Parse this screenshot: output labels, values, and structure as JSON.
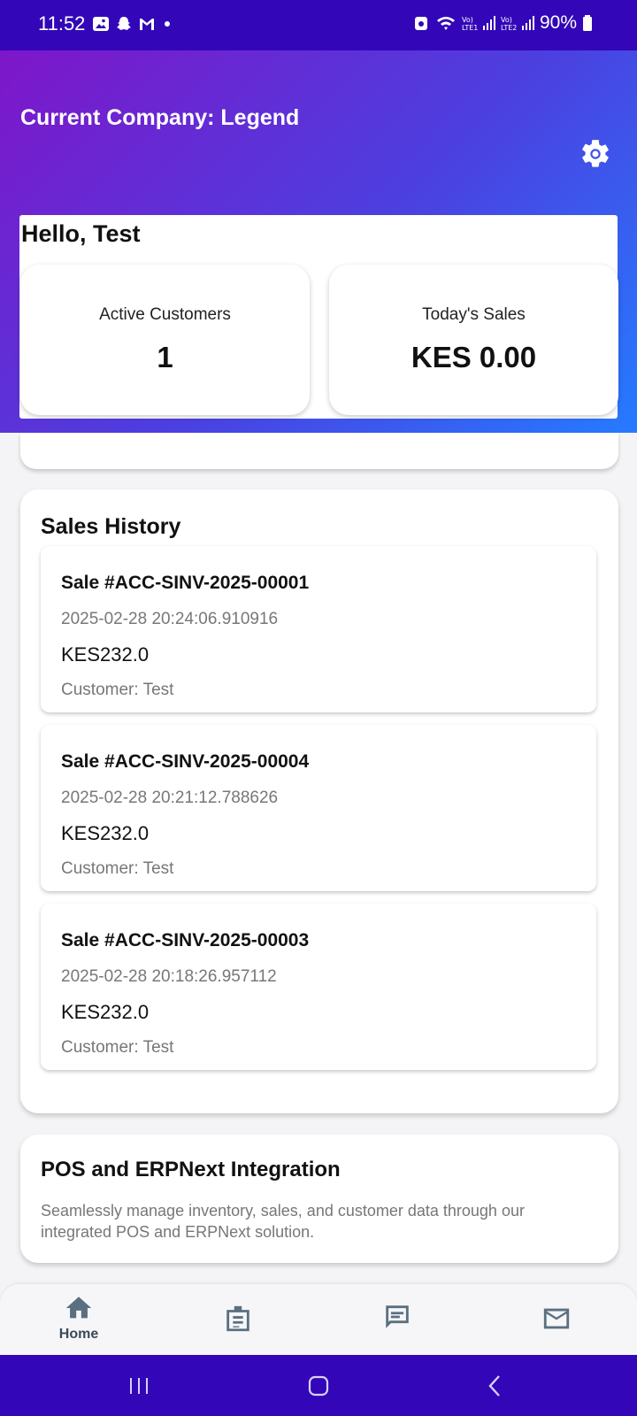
{
  "status_bar": {
    "time": "11:52",
    "battery": "90%",
    "icons": [
      "gallery-icon",
      "snapchat-icon",
      "gmail-icon",
      "wifi-icon",
      "signal-lte1-icon",
      "signal-lte2-icon",
      "battery-icon"
    ]
  },
  "header": {
    "company": "Current Company: Legend",
    "greeting": "Hello, Test",
    "stats": [
      {
        "label": "Active Customers",
        "value": "1"
      },
      {
        "label": "Today's Sales",
        "value": "KES 0.00"
      }
    ]
  },
  "sales_history": {
    "title": "Sales History",
    "items": [
      {
        "title": "Sale #ACC-SINV-2025-00001",
        "date": "2025-02-28 20:24:06.910916",
        "amount": "KES232.0",
        "customer": "Customer: Test"
      },
      {
        "title": "Sale #ACC-SINV-2025-00004",
        "date": "2025-02-28 20:21:12.788626",
        "amount": "KES232.0",
        "customer": "Customer: Test"
      },
      {
        "title": "Sale #ACC-SINV-2025-00003",
        "date": "2025-02-28 20:18:26.957112",
        "amount": "KES232.0",
        "customer": "Customer: Test"
      }
    ]
  },
  "integration": {
    "title": "POS and ERPNext Integration",
    "description": "Seamlessly manage inventory, sales, and customer data through our integrated POS and ERPNext solution."
  },
  "bottom_nav": {
    "items": [
      {
        "label": "Home",
        "icon": "home-icon",
        "active": true
      },
      {
        "label": "",
        "icon": "inventory-icon",
        "active": false
      },
      {
        "label": "",
        "icon": "chat-icon",
        "active": false
      },
      {
        "label": "",
        "icon": "mail-icon",
        "active": false
      }
    ]
  },
  "colors": {
    "status_bar": "#3307b8",
    "gradient_start": "#7e16c9",
    "gradient_end": "#257bff",
    "nav_icon": "#5a7080"
  }
}
